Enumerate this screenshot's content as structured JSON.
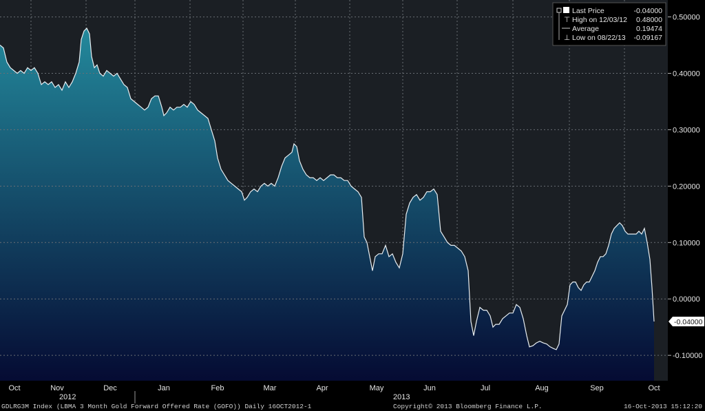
{
  "chart_data": {
    "type": "area",
    "x_months": [
      "Oct",
      "Nov",
      "Dec",
      "Jan",
      "Feb",
      "Mar",
      "Apr",
      "May",
      "Jun",
      "Jul",
      "Aug",
      "Sep",
      "Oct"
    ],
    "year_labels": [
      "2012",
      "2013"
    ],
    "yticks": [
      "0.50000",
      "0.40000",
      "0.30000",
      "0.20000",
      "0.10000",
      "0.00000",
      "-0.10000"
    ],
    "ytick_values": [
      0.5,
      0.4,
      0.3,
      0.2,
      0.1,
      0.0,
      -0.1
    ],
    "ylim": [
      -0.145,
      0.53
    ],
    "grid": true,
    "legend_position": "top-right",
    "last_value_tag": "-0.04000",
    "legend": [
      {
        "label": "Last Price",
        "value": "-0.04000"
      },
      {
        "label": "High on 12/03/12",
        "value": "0.48000"
      },
      {
        "label": "Average",
        "value": "0.19474"
      },
      {
        "label": "Low on 08/22/13",
        "value": "-0.09167"
      }
    ],
    "series": [
      {
        "values": [
          [
            0,
            0.45
          ],
          [
            5,
            0.445
          ],
          [
            10,
            0.42
          ],
          [
            15,
            0.41
          ],
          [
            20,
            0.405
          ],
          [
            25,
            0.4
          ],
          [
            30,
            0.405
          ],
          [
            35,
            0.4
          ],
          [
            40,
            0.41
          ],
          [
            45,
            0.405
          ],
          [
            50,
            0.41
          ],
          [
            55,
            0.4
          ],
          [
            60,
            0.38
          ],
          [
            65,
            0.385
          ],
          [
            70,
            0.38
          ],
          [
            75,
            0.385
          ],
          [
            80,
            0.375
          ],
          [
            85,
            0.38
          ],
          [
            90,
            0.37
          ],
          [
            95,
            0.385
          ],
          [
            100,
            0.375
          ],
          [
            105,
            0.385
          ],
          [
            110,
            0.4
          ],
          [
            115,
            0.42
          ],
          [
            118,
            0.46
          ],
          [
            122,
            0.475
          ],
          [
            126,
            0.48
          ],
          [
            130,
            0.47
          ],
          [
            133,
            0.43
          ],
          [
            137,
            0.41
          ],
          [
            141,
            0.415
          ],
          [
            145,
            0.4
          ],
          [
            150,
            0.395
          ],
          [
            155,
            0.405
          ],
          [
            160,
            0.4
          ],
          [
            165,
            0.395
          ],
          [
            170,
            0.4
          ],
          [
            175,
            0.39
          ],
          [
            180,
            0.38
          ],
          [
            185,
            0.375
          ],
          [
            190,
            0.355
          ],
          [
            195,
            0.35
          ],
          [
            200,
            0.345
          ],
          [
            205,
            0.34
          ],
          [
            210,
            0.335
          ],
          [
            215,
            0.34
          ],
          [
            220,
            0.355
          ],
          [
            225,
            0.36
          ],
          [
            230,
            0.36
          ],
          [
            235,
            0.34
          ],
          [
            238,
            0.325
          ],
          [
            242,
            0.33
          ],
          [
            247,
            0.34
          ],
          [
            252,
            0.335
          ],
          [
            257,
            0.34
          ],
          [
            262,
            0.34
          ],
          [
            267,
            0.345
          ],
          [
            272,
            0.34
          ],
          [
            277,
            0.35
          ],
          [
            282,
            0.345
          ],
          [
            287,
            0.335
          ],
          [
            292,
            0.33
          ],
          [
            297,
            0.325
          ],
          [
            302,
            0.32
          ],
          [
            307,
            0.3
          ],
          [
            312,
            0.28
          ],
          [
            316,
            0.25
          ],
          [
            321,
            0.23
          ],
          [
            326,
            0.22
          ],
          [
            331,
            0.21
          ],
          [
            336,
            0.205
          ],
          [
            341,
            0.2
          ],
          [
            346,
            0.195
          ],
          [
            351,
            0.19
          ],
          [
            355,
            0.175
          ],
          [
            359,
            0.18
          ],
          [
            364,
            0.19
          ],
          [
            369,
            0.195
          ],
          [
            374,
            0.19
          ],
          [
            379,
            0.2
          ],
          [
            384,
            0.205
          ],
          [
            389,
            0.2
          ],
          [
            394,
            0.205
          ],
          [
            399,
            0.2
          ],
          [
            404,
            0.215
          ],
          [
            409,
            0.235
          ],
          [
            414,
            0.25
          ],
          [
            419,
            0.255
          ],
          [
            424,
            0.26
          ],
          [
            427,
            0.275
          ],
          [
            431,
            0.27
          ],
          [
            435,
            0.245
          ],
          [
            440,
            0.23
          ],
          [
            445,
            0.22
          ],
          [
            450,
            0.215
          ],
          [
            455,
            0.215
          ],
          [
            460,
            0.21
          ],
          [
            465,
            0.215
          ],
          [
            470,
            0.21
          ],
          [
            475,
            0.215
          ],
          [
            480,
            0.22
          ],
          [
            485,
            0.22
          ],
          [
            490,
            0.215
          ],
          [
            495,
            0.215
          ],
          [
            500,
            0.21
          ],
          [
            505,
            0.21
          ],
          [
            510,
            0.2
          ],
          [
            515,
            0.195
          ],
          [
            520,
            0.19
          ],
          [
            525,
            0.18
          ],
          [
            529,
            0.11
          ],
          [
            533,
            0.1
          ],
          [
            537,
            0.075
          ],
          [
            541,
            0.05
          ],
          [
            545,
            0.075
          ],
          [
            550,
            0.08
          ],
          [
            555,
            0.08
          ],
          [
            560,
            0.095
          ],
          [
            565,
            0.075
          ],
          [
            570,
            0.08
          ],
          [
            575,
            0.065
          ],
          [
            580,
            0.055
          ],
          [
            585,
            0.08
          ],
          [
            590,
            0.15
          ],
          [
            595,
            0.17
          ],
          [
            600,
            0.18
          ],
          [
            605,
            0.185
          ],
          [
            610,
            0.175
          ],
          [
            615,
            0.18
          ],
          [
            620,
            0.19
          ],
          [
            625,
            0.19
          ],
          [
            630,
            0.195
          ],
          [
            635,
            0.185
          ],
          [
            640,
            0.12
          ],
          [
            645,
            0.11
          ],
          [
            650,
            0.1
          ],
          [
            655,
            0.095
          ],
          [
            660,
            0.095
          ],
          [
            665,
            0.09
          ],
          [
            670,
            0.085
          ],
          [
            675,
            0.075
          ],
          [
            680,
            0.05
          ],
          [
            684,
            -0.04
          ],
          [
            688,
            -0.065
          ],
          [
            692,
            -0.04
          ],
          [
            697,
            -0.015
          ],
          [
            702,
            -0.02
          ],
          [
            707,
            -0.02
          ],
          [
            712,
            -0.03
          ],
          [
            716,
            -0.05
          ],
          [
            720,
            -0.045
          ],
          [
            725,
            -0.045
          ],
          [
            730,
            -0.035
          ],
          [
            735,
            -0.03
          ],
          [
            740,
            -0.025
          ],
          [
            745,
            -0.025
          ],
          [
            750,
            -0.01
          ],
          [
            755,
            -0.015
          ],
          [
            760,
            -0.035
          ],
          [
            765,
            -0.065
          ],
          [
            769,
            -0.085
          ],
          [
            774,
            -0.083
          ],
          [
            779,
            -0.078
          ],
          [
            784,
            -0.075
          ],
          [
            789,
            -0.078
          ],
          [
            794,
            -0.08
          ],
          [
            799,
            -0.085
          ],
          [
            804,
            -0.088
          ],
          [
            808,
            -0.09
          ],
          [
            812,
            -0.08
          ],
          [
            816,
            -0.03
          ],
          [
            820,
            -0.02
          ],
          [
            824,
            -0.01
          ],
          [
            828,
            0.025
          ],
          [
            832,
            0.03
          ],
          [
            836,
            0.03
          ],
          [
            840,
            0.02
          ],
          [
            844,
            0.015
          ],
          [
            848,
            0.025
          ],
          [
            852,
            0.03
          ],
          [
            856,
            0.03
          ],
          [
            860,
            0.04
          ],
          [
            864,
            0.05
          ],
          [
            868,
            0.065
          ],
          [
            872,
            0.075
          ],
          [
            876,
            0.075
          ],
          [
            880,
            0.08
          ],
          [
            884,
            0.095
          ],
          [
            888,
            0.115
          ],
          [
            892,
            0.125
          ],
          [
            896,
            0.13
          ],
          [
            900,
            0.135
          ],
          [
            904,
            0.13
          ],
          [
            908,
            0.12
          ],
          [
            912,
            0.115
          ],
          [
            916,
            0.115
          ],
          [
            920,
            0.115
          ],
          [
            924,
            0.115
          ],
          [
            928,
            0.12
          ],
          [
            932,
            0.115
          ],
          [
            936,
            0.125
          ],
          [
            940,
            0.1
          ],
          [
            944,
            0.07
          ],
          [
            947,
            0.02
          ],
          [
            950,
            -0.04
          ]
        ]
      }
    ]
  },
  "footer": {
    "left": "GDLRG3M Index (LBMA 3 Month Gold Forward Offered Rate (GOFO))  Daily 16OCT2012-1",
    "center": "Copyright© 2013 Bloomberg Finance L.P.",
    "right": "16-Oct-2013 15:12:20"
  },
  "colors": {
    "background": "#1b1f24",
    "area_top": "#23899c",
    "area_bottom": "#050b33",
    "line": "#e8eef2",
    "grid": "#6a6f75"
  }
}
